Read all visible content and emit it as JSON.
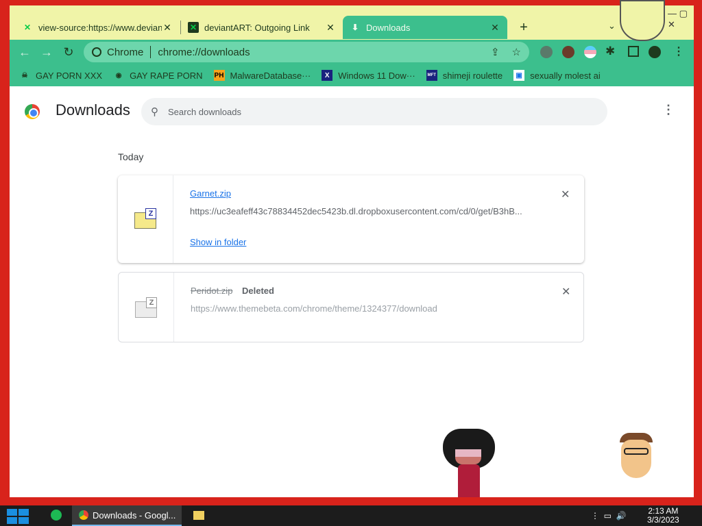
{
  "tabs": [
    {
      "title": "view-source:https://www.deviantart",
      "favicon": "deviantart-icon",
      "active": false
    },
    {
      "title": "deviantART: Outgoing Link",
      "favicon": "deviantart-icon",
      "active": false
    },
    {
      "title": "Downloads",
      "favicon": "download-icon",
      "active": true
    }
  ],
  "toolbar": {
    "omnibox_label": "Chrome",
    "url": "chrome://downloads"
  },
  "bookmarks": [
    {
      "label": "GAY PORN XXX"
    },
    {
      "label": "GAY RAPE PORN"
    },
    {
      "label": "MalwareDatabase···",
      "icon_text": "PH"
    },
    {
      "label": "Windows 11 Dow···"
    },
    {
      "label": "shimeji roulette",
      "icon_text": "MFT"
    },
    {
      "label": "sexually molest ai"
    }
  ],
  "page": {
    "title": "Downloads",
    "search_placeholder": "Search downloads",
    "section_label": "Today"
  },
  "downloads": [
    {
      "filename": "Garnet.zip",
      "url": "https://uc3eafeff43c78834452dec5423b.dl.dropboxusercontent.com/cd/0/get/B3hB...",
      "action": "Show in folder",
      "status": ""
    },
    {
      "filename": "Peridot.zip",
      "url": "https://www.themebeta.com/chrome/theme/1324377/download",
      "action": "",
      "status": "Deleted"
    }
  ],
  "taskbar": {
    "chrome_label": "Downloads - Googl...",
    "time": "2:13 AM",
    "date": "3/3/2023"
  },
  "colors": {
    "theme_green": "#3cbf8d",
    "tabbar_yellow": "#f0f4a8",
    "desktop_red": "#d8231b",
    "link_blue": "#1a73e8"
  }
}
